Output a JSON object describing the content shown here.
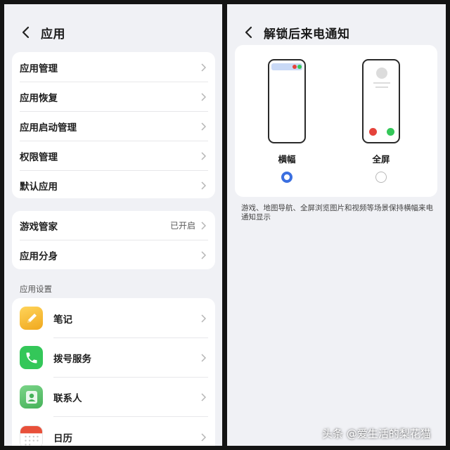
{
  "left": {
    "title": "应用",
    "group1": [
      "应用管理",
      "应用恢复",
      "应用启动管理",
      "权限管理",
      "默认应用"
    ],
    "group2": [
      {
        "label": "游戏管家",
        "value": "已开启"
      },
      {
        "label": "应用分身",
        "value": ""
      }
    ],
    "section_title": "应用设置",
    "apps": [
      {
        "label": "笔记",
        "icon": "notes-icon",
        "color": "#f5b731"
      },
      {
        "label": "拨号服务",
        "icon": "phone-icon",
        "color": "#34c759"
      },
      {
        "label": "联系人",
        "icon": "contacts-icon",
        "color": "#5cc66b"
      },
      {
        "label": "日历",
        "icon": "calendar-icon",
        "color": "#e8503a"
      }
    ]
  },
  "right": {
    "title": "解锁后来电通知",
    "options": [
      {
        "label": "横幅",
        "selected": true
      },
      {
        "label": "全屏",
        "selected": false
      }
    ],
    "description": "游戏、地图导航、全屏浏览图片和视频等场景保持横幅来电通知显示"
  },
  "watermark": "头条 @爱生活的梨花猫",
  "colors": {
    "accent": "#3b6fe0",
    "accept": "#34c759",
    "decline": "#e5433b",
    "background": "#f0f1f5"
  }
}
